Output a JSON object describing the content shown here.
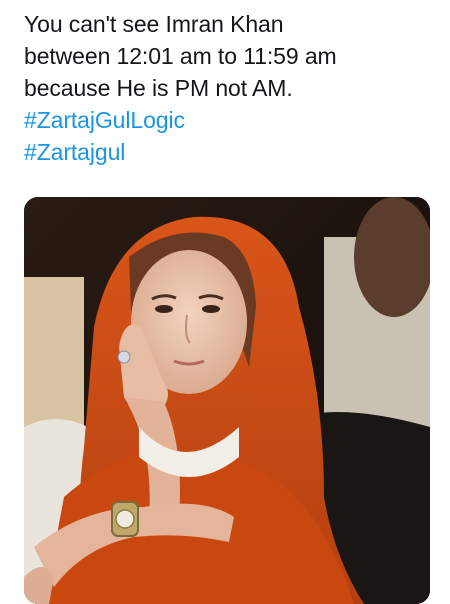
{
  "tweet": {
    "lines": [
      "You can't see Imran Khan",
      "between 12:01 am to 11:59 am",
      "because He is PM not AM."
    ],
    "hashtags": [
      "#ZartajGulLogic",
      "#Zartajgul"
    ]
  },
  "media": {
    "alt": "woman-in-orange-dupatta-photo"
  },
  "colors": {
    "text": "#14171a",
    "hashtag": "#1b95e0",
    "background": "#ffffff"
  }
}
